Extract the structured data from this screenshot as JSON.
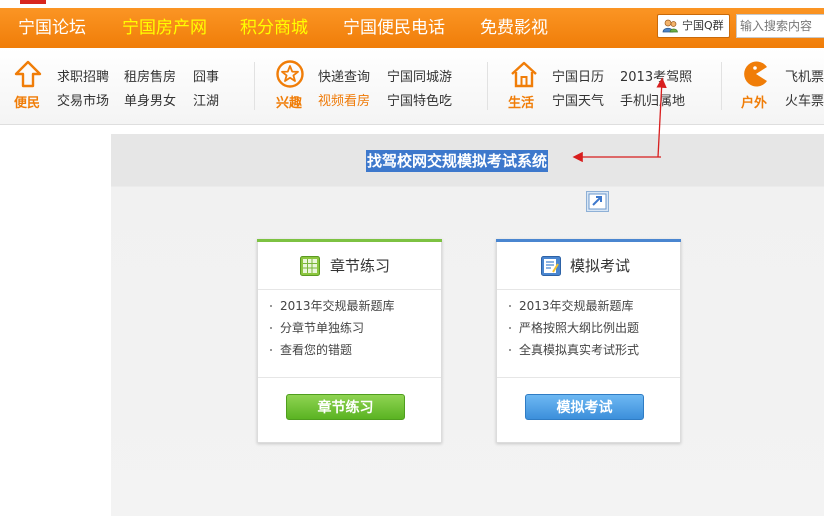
{
  "topnav": {
    "items": [
      {
        "label": "宁国论坛",
        "color": "#ffffff"
      },
      {
        "label": "宁国房产网",
        "color": "#ffff00"
      },
      {
        "label": "积分商城",
        "color": "#ffff00"
      },
      {
        "label": "宁国便民电话",
        "color": "#ffffff"
      },
      {
        "label": "免费影视",
        "color": "#ffffff"
      }
    ],
    "qq_group_label": "宁国Q群",
    "search_placeholder": "输入搜索内容"
  },
  "linkbar": {
    "groups": [
      {
        "label": "便民",
        "icon": "up-arrow-icon",
        "links": [
          "求职招聘",
          "租房售房",
          "囧事",
          "交易市场",
          "单身男女",
          "江湖"
        ]
      },
      {
        "label": "兴趣",
        "icon": "star-circle-icon",
        "links": [
          "快递查询",
          "宁国同城游",
          "视频看房",
          "宁国特色吃"
        ]
      },
      {
        "label": "生活",
        "icon": "house-icon",
        "links": [
          "宁国日历",
          "2013考驾照",
          "宁国天气",
          "手机归属地"
        ]
      },
      {
        "label": "户外",
        "icon": "pacman-icon",
        "links": [
          "飞机票",
          "火车票"
        ]
      }
    ]
  },
  "main": {
    "title": "找驾校网交规模拟考试系统",
    "cards": [
      {
        "title": "章节练习",
        "accent": "#7dc242",
        "items": [
          "2013年交规最新题库",
          "分章节单独练习",
          "查看您的错题"
        ],
        "button": "章节练习"
      },
      {
        "title": "模拟考试",
        "accent": "#4a86d0",
        "items": [
          "2013年交规最新题库",
          "严格按照大纲比例出题",
          "全真模拟真实考试形式"
        ],
        "button": "模拟考试"
      }
    ]
  },
  "colors": {
    "nav_orange": "#f58a15",
    "annotation_red": "#d81e1e",
    "title_highlight": "#3d78cc"
  }
}
